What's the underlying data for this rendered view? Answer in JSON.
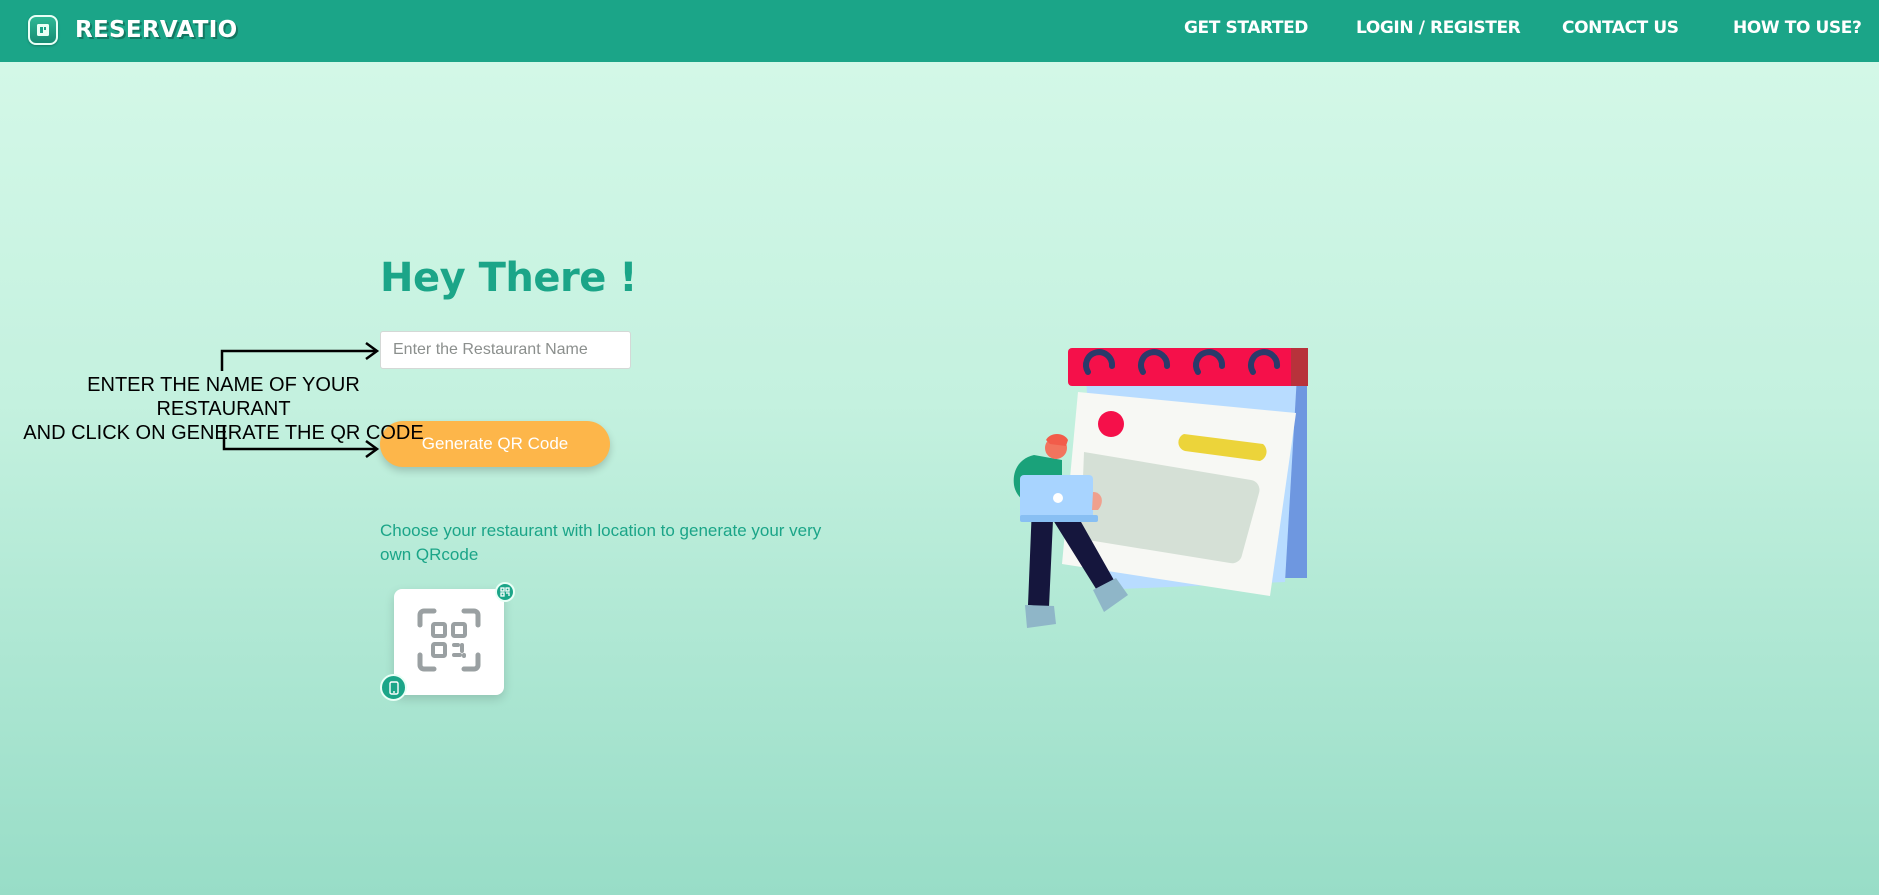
{
  "header": {
    "brand_name": "RESERVATIO",
    "brand_icon": "reservatio-logo-icon",
    "nav": [
      {
        "label": "GET STARTED"
      },
      {
        "label": "LOGIN / REGISTER"
      },
      {
        "label": "CONTACT US"
      },
      {
        "label": "HOW TO USE?"
      }
    ]
  },
  "main": {
    "headline": "Hey There !",
    "restaurant_input": {
      "placeholder": "Enter the Restaurant Name",
      "value": ""
    },
    "generate_button": "Generate QR Code",
    "help_text": "Choose your restaurant with location to generate your very own QRcode"
  },
  "annotation": {
    "line1": "ENTER THE NAME OF YOUR RESTAURANT",
    "line2": "AND CLICK ON GENERATE THE QR CODE"
  },
  "icons": {
    "qr_card": "qr-scan-icon",
    "qr_badge": "qr-small-icon",
    "phone_badge": "phone-icon",
    "illustration": "calendar-person-illustration"
  },
  "colors": {
    "header_bg": "#1ba588",
    "accent": "#1ba588",
    "button": "#fdb64a",
    "background_top": "#d6f9e9",
    "background_bottom": "#98ddc7"
  }
}
